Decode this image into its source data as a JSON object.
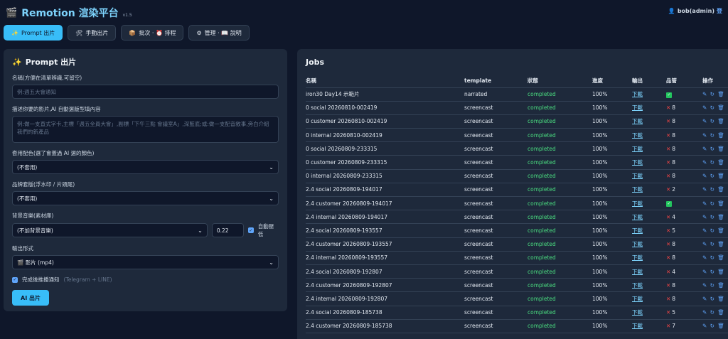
{
  "header": {
    "logo_icon": "🎬",
    "title": "Remotion 渲染平台",
    "version": "v1.5",
    "user_icon": "👤",
    "user": "bob(admin)",
    "user_extra": "登"
  },
  "tabs": [
    {
      "icon": "✨",
      "label": "Prompt 出片",
      "active": true
    },
    {
      "icon": "🛠",
      "label": "手動出片"
    },
    {
      "icon": "📦",
      "label": "批次 · ⏰ 排程"
    },
    {
      "icon": "⚙",
      "label": "管理 · 📖 說明"
    }
  ],
  "form": {
    "title_icon": "✨",
    "title": "Prompt 出片",
    "name_label": "名稱(方便在清單辨識,可留空)",
    "name_placeholder": "例:週五大會通知",
    "prompt_label": "描述你要的影片,AI 自動選版型填內容",
    "prompt_placeholder": "例:做一支直式字卡,主標「週五全員大會」,副標「下午三點 會議室A」,深藍底;或:做一支配音敘事,旁白介紹我們的新產品",
    "palette_label": "套用配色(選了會蓋過 AI 選的顏色)",
    "palette_value": "(不套用)",
    "brand_label": "品牌套版(浮水印 / 片頭尾)",
    "brand_value": "(不套用)",
    "music_label": "背景音樂(素材庫)",
    "music_value": "(不加背景音樂)",
    "volume_value": "0.22",
    "ducking_label": "自動壓低",
    "format_label": "輸出形式",
    "format_value": "🎬 影片 (mp4)",
    "notify_label": "完成後推播通知",
    "notify_hint": "(Telegram + LINE)",
    "submit_label": "AI 出片"
  },
  "jobs": {
    "title": "Jobs",
    "columns": [
      "名稱",
      "template",
      "狀態",
      "進度",
      "輸出",
      "品管",
      "操作"
    ],
    "rows": [
      {
        "name": "iron30 Day14 示範片",
        "template": "narrated",
        "status": "completed",
        "progress": "100%",
        "output": "下載",
        "qc_pass": true,
        "qc": "",
        "ops": "✎ ↻ 🗑"
      },
      {
        "name": "0 social 20260810-002419",
        "template": "screencast",
        "status": "completed",
        "progress": "100%",
        "output": "下載",
        "qc_pass": false,
        "qc": "8",
        "ops": "✎ ↻ 🗑"
      },
      {
        "name": "0 customer 20260810-002419",
        "template": "screencast",
        "status": "completed",
        "progress": "100%",
        "output": "下載",
        "qc_pass": false,
        "qc": "8",
        "ops": "✎ ↻ 🗑"
      },
      {
        "name": "0 internal 20260810-002419",
        "template": "screencast",
        "status": "completed",
        "progress": "100%",
        "output": "下載",
        "qc_pass": false,
        "qc": "8",
        "ops": "✎ ↻ 🗑"
      },
      {
        "name": "0 social 20260809-233315",
        "template": "screencast",
        "status": "completed",
        "progress": "100%",
        "output": "下載",
        "qc_pass": false,
        "qc": "8",
        "ops": "✎ ↻ 🗑"
      },
      {
        "name": "0 customer 20260809-233315",
        "template": "screencast",
        "status": "completed",
        "progress": "100%",
        "output": "下載",
        "qc_pass": false,
        "qc": "8",
        "ops": "✎ ↻ 🗑"
      },
      {
        "name": "0 internal 20260809-233315",
        "template": "screencast",
        "status": "completed",
        "progress": "100%",
        "output": "下載",
        "qc_pass": false,
        "qc": "8",
        "ops": "✎ ↻ 🗑"
      },
      {
        "name": "2.4 social 20260809-194017",
        "template": "screencast",
        "status": "completed",
        "progress": "100%",
        "output": "下載",
        "qc_pass": false,
        "qc": "2",
        "ops": "✎ ↻ 🗑"
      },
      {
        "name": "2.4 customer 20260809-194017",
        "template": "screencast",
        "status": "completed",
        "progress": "100%",
        "output": "下載",
        "qc_pass": true,
        "qc": "",
        "ops": "✎ ↻ 🗑"
      },
      {
        "name": "2.4 internal 20260809-194017",
        "template": "screencast",
        "status": "completed",
        "progress": "100%",
        "output": "下載",
        "qc_pass": false,
        "qc": "4",
        "ops": "✎ ↻ 🗑"
      },
      {
        "name": "2.4 social 20260809-193557",
        "template": "screencast",
        "status": "completed",
        "progress": "100%",
        "output": "下載",
        "qc_pass": false,
        "qc": "5",
        "ops": "✎ ↻ 🗑"
      },
      {
        "name": "2.4 customer 20260809-193557",
        "template": "screencast",
        "status": "completed",
        "progress": "100%",
        "output": "下載",
        "qc_pass": false,
        "qc": "8",
        "ops": "✎ ↻ 🗑"
      },
      {
        "name": "2.4 internal 20260809-193557",
        "template": "screencast",
        "status": "completed",
        "progress": "100%",
        "output": "下載",
        "qc_pass": false,
        "qc": "8",
        "ops": "✎ ↻ 🗑"
      },
      {
        "name": "2.4 social 20260809-192807",
        "template": "screencast",
        "status": "completed",
        "progress": "100%",
        "output": "下載",
        "qc_pass": false,
        "qc": "4",
        "ops": "✎ ↻ 🗑"
      },
      {
        "name": "2.4 customer 20260809-192807",
        "template": "screencast",
        "status": "completed",
        "progress": "100%",
        "output": "下載",
        "qc_pass": false,
        "qc": "8",
        "ops": "✎ ↻ 🗑"
      },
      {
        "name": "2.4 internal 20260809-192807",
        "template": "screencast",
        "status": "completed",
        "progress": "100%",
        "output": "下載",
        "qc_pass": false,
        "qc": "8",
        "ops": "✎ ↻ 🗑"
      },
      {
        "name": "2.4 social 20260809-185738",
        "template": "screencast",
        "status": "completed",
        "progress": "100%",
        "output": "下載",
        "qc_pass": false,
        "qc": "5",
        "ops": "✎ ↻ 🗑"
      },
      {
        "name": "2.4 customer 20260809-185738",
        "template": "screencast",
        "status": "completed",
        "progress": "100%",
        "output": "下載",
        "qc_pass": false,
        "qc": "7",
        "ops": "✎ ↻ 🗑"
      }
    ]
  }
}
